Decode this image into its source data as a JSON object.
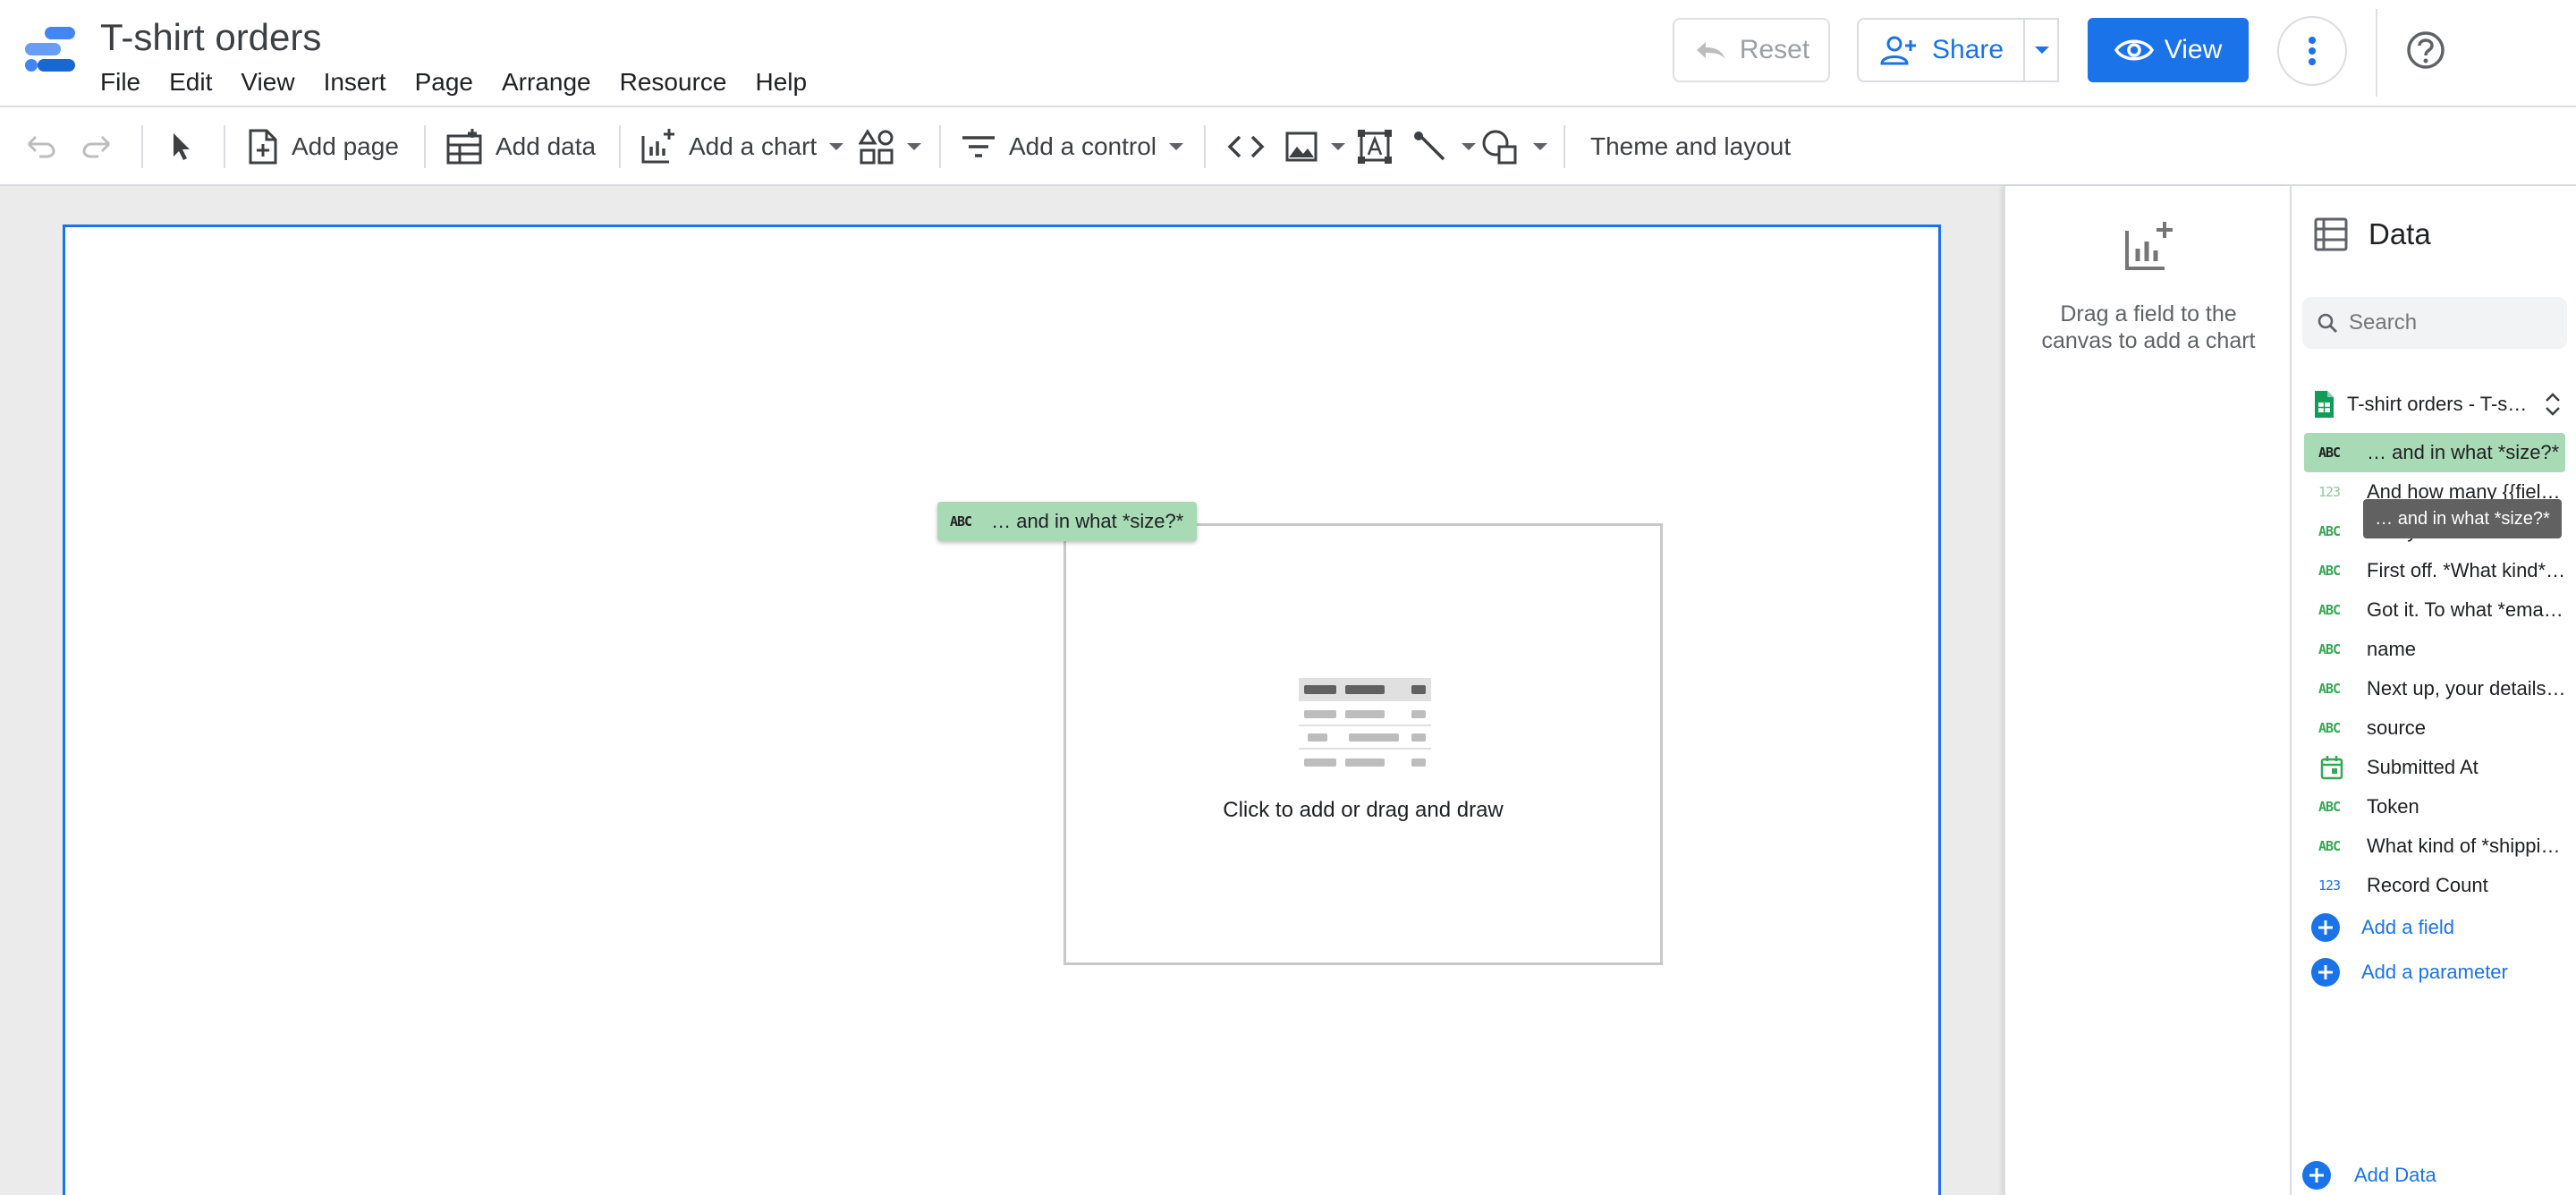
{
  "header": {
    "title": "T-shirt orders",
    "menu": [
      "File",
      "Edit",
      "View",
      "Insert",
      "Page",
      "Arrange",
      "Resource",
      "Help"
    ],
    "reset_label": "Reset",
    "share_label": "Share",
    "view_label": "View"
  },
  "toolbar": {
    "add_page": "Add page",
    "add_data": "Add data",
    "add_chart": "Add a chart",
    "add_control": "Add a control",
    "theme_layout": "Theme and layout"
  },
  "canvas": {
    "placeholder_text": "Click to add or drag and draw",
    "drag_chip_type": "ABC",
    "drag_chip_label": "… and in what *size?*"
  },
  "properties": {
    "hint_line1": "Drag a field to the",
    "hint_line2": "canvas to add a chart"
  },
  "data_panel": {
    "title": "Data",
    "search_placeholder": "Search",
    "source_name": "T-shirt orders - T-s…",
    "fields": [
      {
        "type": "ABC",
        "name": "… and in what *size?*"
      },
      {
        "type": "123",
        "name": "And how many {{field:…"
      },
      {
        "type": "ABC",
        "name": "And your last name?"
      },
      {
        "type": "ABC",
        "name": "First off. *What kind* …"
      },
      {
        "type": "ABC",
        "name": "Got it. To what *email…"
      },
      {
        "type": "ABC",
        "name": "name"
      },
      {
        "type": "ABC",
        "name": "Next up, your details. …"
      },
      {
        "type": "ABC",
        "name": "source"
      },
      {
        "type": "date",
        "name": "Submitted At"
      },
      {
        "type": "ABC",
        "name": "Token"
      },
      {
        "type": "ABC",
        "name": "What kind of *shippin…"
      },
      {
        "type": "123",
        "name": "Record Count"
      }
    ],
    "add_field": "Add a field",
    "add_parameter": "Add a parameter",
    "tooltip": "… and in what *size?*",
    "add_data": "Add Data"
  },
  "colors": {
    "accent": "#1a73e8",
    "field_highlight": "#a8dab5",
    "dimension_green": "#34a853",
    "canvas_bg": "#ebebeb"
  }
}
